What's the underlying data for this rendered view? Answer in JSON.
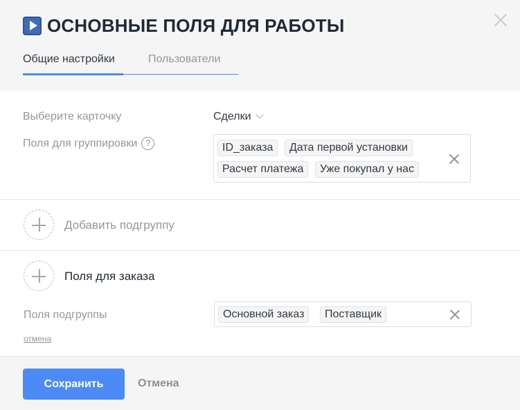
{
  "modal": {
    "title": "ОСНОВНЫЕ ПОЛЯ ДЛЯ РАБОТЫ",
    "icon": "play-square-icon",
    "accent_color": "#4c8bf5"
  },
  "tabs": [
    {
      "label": "Общие настройки",
      "active": true
    },
    {
      "label": "Пользователи",
      "active": false
    }
  ],
  "settings": {
    "card_label": "Выберите карточку",
    "card_value": "Сделки",
    "grouping_label": "Поля для группировки",
    "help_glyph": "?",
    "grouping_tags": [
      "ID_заказа",
      "Дата первой установки",
      "Расчет платежа",
      "Уже покупал у нас"
    ]
  },
  "add_subgroup": {
    "label": "Добавить подгруппу"
  },
  "subgroup": {
    "name": "Поля для заказа",
    "fields_label": "Поля подгруппы",
    "tags": [
      "Основной заказ",
      "Поставщик"
    ],
    "cancel_link": "отмена"
  },
  "footer": {
    "save_label": "Сохранить",
    "cancel_label": "Отмена"
  }
}
